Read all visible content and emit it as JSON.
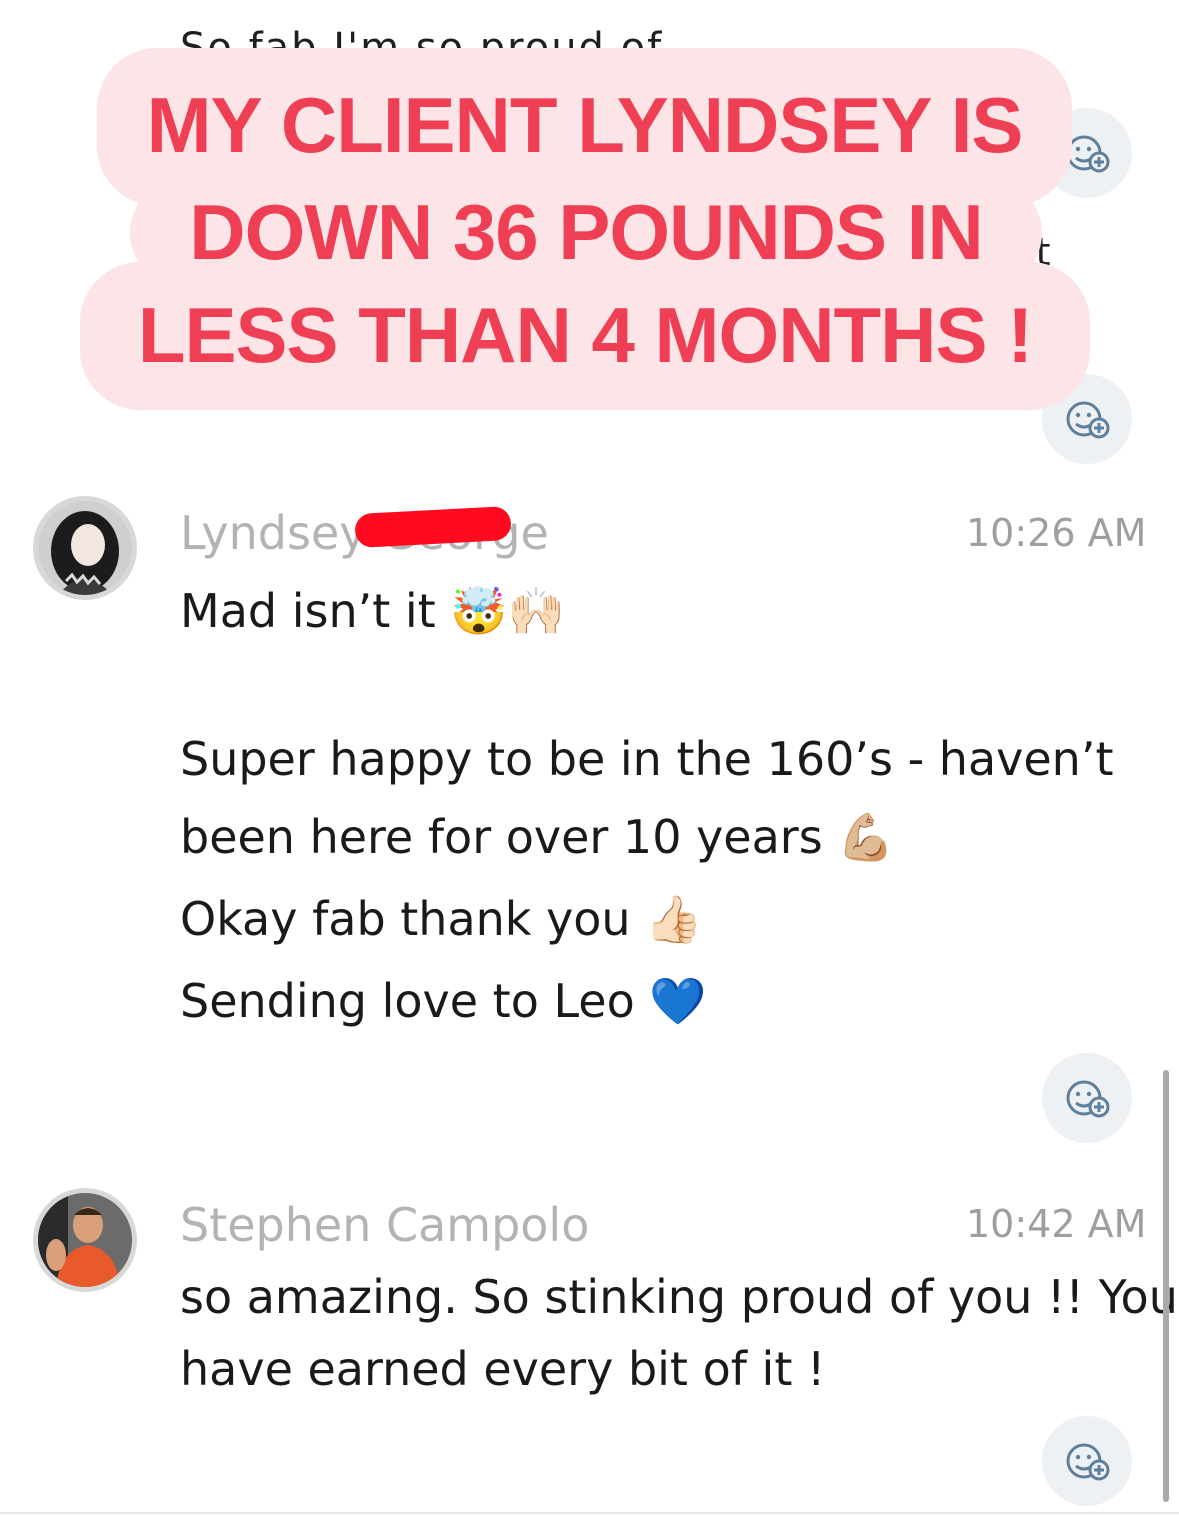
{
  "top": {
    "cut_text": "So fab I'm so proud of",
    "cut_right": "rt"
  },
  "banner": {
    "line1": "MY CLIENT LYNDSEY IS",
    "line2": "DOWN 36 POUNDS IN",
    "line3": "LESS THAN 4 MONTHS !"
  },
  "messages": [
    {
      "sender": "Lyndsey George",
      "time": "10:26 AM",
      "lines": [
        "Mad isn’t it 🤯🙌🏻",
        "Super happy to be in the 160’s - haven’t",
        "been here for over 10 years 💪🏼",
        "Okay fab thank you 👍🏻",
        "Sending love to Leo 💙"
      ]
    },
    {
      "sender": "Stephen Campolo",
      "time": "10:42 AM",
      "lines": [
        "so amazing. So stinking proud of you !! You",
        "have earned every bit of it !"
      ]
    }
  ],
  "icons": {
    "reaction": "add-reaction-icon"
  },
  "colors": {
    "banner_bg": "#fde4e6",
    "banner_text": "#ef3f54",
    "redaction": "#ff0a1e"
  }
}
